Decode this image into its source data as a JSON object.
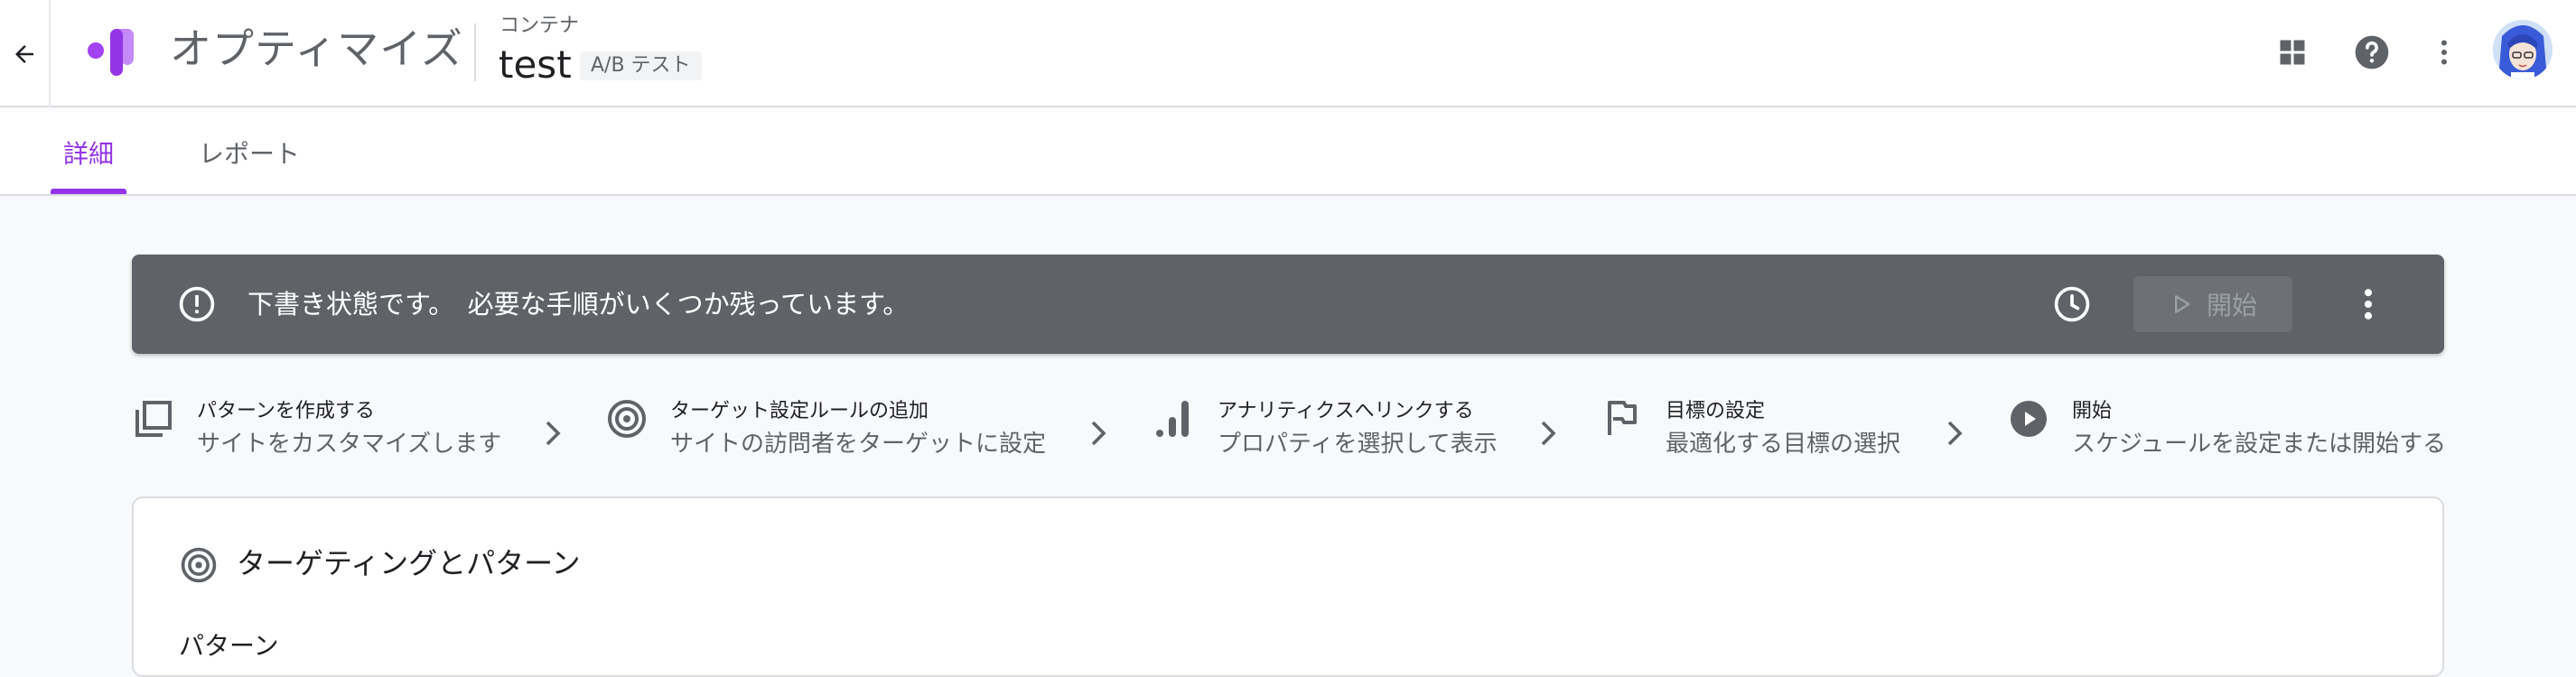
{
  "app": {
    "name": "オプティマイズ",
    "container_label": "コンテナ",
    "experience_name": "test",
    "experience_type": "A/B テスト"
  },
  "icons": {
    "back": "arrow-back-icon",
    "apps": "apps-grid-icon",
    "help": "help-icon",
    "more": "more-vert-icon",
    "avatar": "user-avatar"
  },
  "tabs": [
    {
      "label": "詳細",
      "active": true
    },
    {
      "label": "レポート",
      "active": false
    }
  ],
  "banner": {
    "message": "下書き状態です。　必要な手順がいくつか残っています。",
    "start_label": "開始"
  },
  "steps": [
    {
      "title": "パターンを作成する",
      "subtitle": "サイトをカスタマイズします",
      "icon": "variants-icon"
    },
    {
      "title": "ターゲット設定ルールの追加",
      "subtitle": "サイトの訪問者をターゲットに設定",
      "icon": "target-icon"
    },
    {
      "title": "アナリティクスへリンクする",
      "subtitle": "プロパティを選択して表示",
      "icon": "analytics-icon"
    },
    {
      "title": "目標の設定",
      "subtitle": "最適化する目標の選択",
      "icon": "flag-icon"
    },
    {
      "title": "開始",
      "subtitle": "スケジュールを設定または開始する",
      "icon": "play-circle-icon"
    }
  ],
  "card": {
    "title": "ターゲティングとパターン",
    "section_label": "パターン"
  },
  "colors": {
    "accent": "#9334e6",
    "banner_bg": "#5f6368",
    "text_secondary": "#5f6368"
  }
}
